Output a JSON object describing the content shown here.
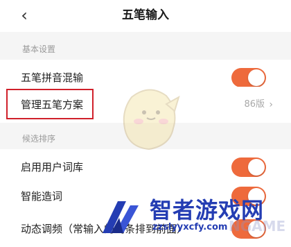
{
  "nav": {
    "back_icon": "chevron-left-icon",
    "title": "五笔输入"
  },
  "sections": [
    {
      "title": "基本设置"
    },
    {
      "title": "候选排序"
    }
  ],
  "rows": [
    {
      "label": "五笔拼音混输",
      "control": "toggle",
      "on": true
    },
    {
      "label": "管理五笔方案",
      "control": "link",
      "value": "86版"
    },
    {
      "label": "启用用户词库",
      "control": "toggle",
      "on": true
    },
    {
      "label": "智能造词",
      "control": "toggle",
      "on": true
    },
    {
      "label": "动态调频（常输入的词条排到前面）",
      "control": "toggle",
      "on": true
    }
  ],
  "watermark": {
    "site_name": "智者游戏网",
    "url": "zzslyyxcfy.com",
    "faint_text": "NGAME"
  },
  "colors": {
    "toggle_on": "#ee6a3c",
    "highlight_border": "#d0202a",
    "watermark_blue": "#243db3",
    "section_bg": "#f5f5f5"
  }
}
